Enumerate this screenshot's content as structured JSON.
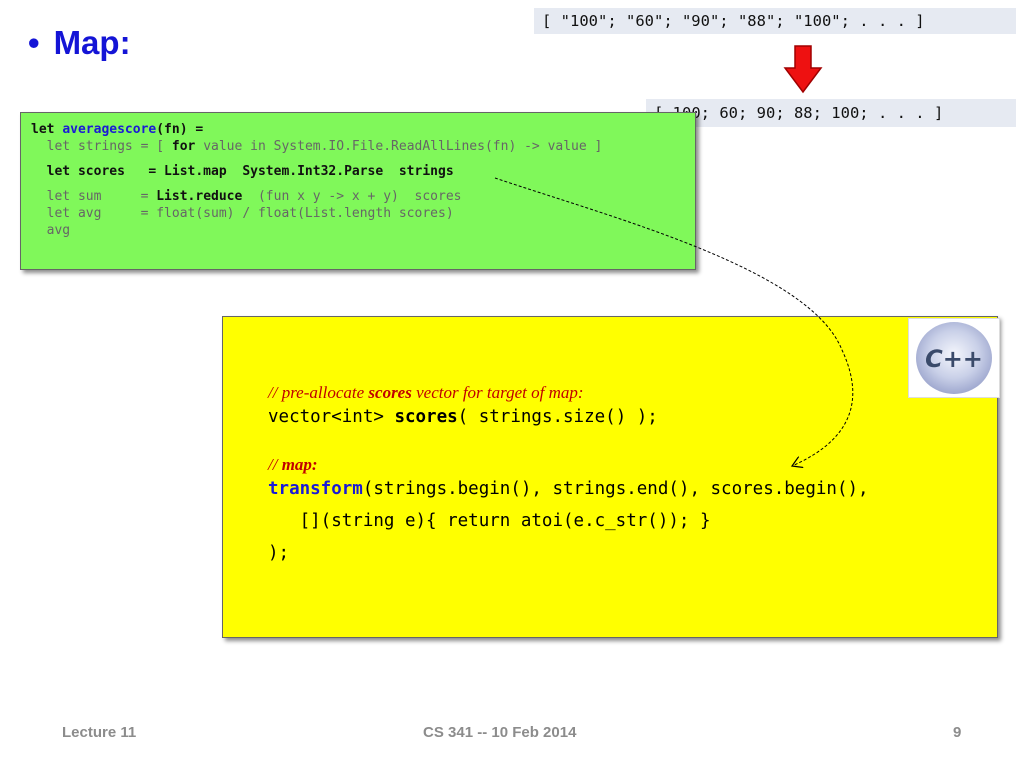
{
  "slide": {
    "bullet": "•",
    "title": "Map:"
  },
  "string_list": "[ \"100\"; \"60\"; \"90\"; \"88\"; \"100\"; . . . ]",
  "number_list": "[ 100; 60; 90; 88; 100; . . . ]",
  "fsharp": {
    "l1_let": "let ",
    "l1_name": "averagescore",
    "l1_rest": "(fn) =",
    "l2_a": "  let strings = [ ",
    "l2_for": "for",
    "l2_b": " value in System.IO.File.ReadAllLines(fn) -> value ]",
    "l3": "  let scores   = List.map  System.Int32.Parse  strings",
    "l4_a": "  let sum     = ",
    "l4_reduce": "List.reduce",
    "l4_b": "  (fun x y -> x + y)  scores",
    "l5": "  let avg     = float(sum) / float(List.length scores)",
    "l6": "  avg"
  },
  "cpp": {
    "c1_a": "// pre-allocate ",
    "c1_b": "scores",
    "c1_c": " vector for target of map:",
    "l2_a": "vector<int> ",
    "l2_b": "scores",
    "l2_c": "( strings.size() );",
    "c3_a": "// ",
    "c3_b": "map:",
    "l4_a": "transform",
    "l4_b": "(strings.begin(), strings.end(), scores.begin(),",
    "l5": "   [](string e){ return atoi(e.c_str()); }",
    "l6": ");"
  },
  "logo_text": "C++",
  "footer": {
    "left": "Lecture 11",
    "center": "CS 341 -- 10 Feb 2014",
    "right": "9"
  },
  "colors": {
    "title": "#1414d6",
    "fsharp_box": "#80f85a",
    "cpp_box": "#ffff00",
    "arrow": "#ee1111",
    "comment": "#c00000"
  }
}
